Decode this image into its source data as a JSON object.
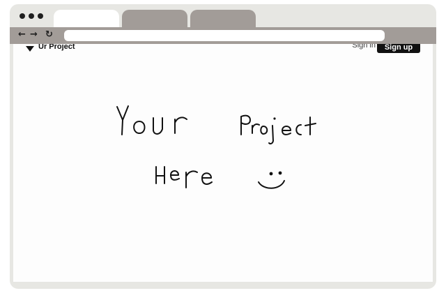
{
  "browser": {
    "tabs": [
      {
        "label": "",
        "state": "active"
      },
      {
        "label": "",
        "state": "inactive"
      },
      {
        "label": "",
        "state": "inactive"
      }
    ],
    "address_value": "",
    "colors": {
      "frame": "#e7e7e3",
      "tab_inactive": "#a29c98",
      "toolbar": "#a29c98",
      "page": "#fdfdfd"
    },
    "icons": [
      "back-arrow-icon",
      "forward-arrow-icon",
      "reload-icon"
    ]
  },
  "site": {
    "brand": "Ur Project",
    "sign_in": "Sign in",
    "sign_up": "Sign up"
  },
  "content": {
    "handwritten_line_1": "Your Project",
    "handwritten_line_2": "Here",
    "doodle": "smiley-face"
  }
}
